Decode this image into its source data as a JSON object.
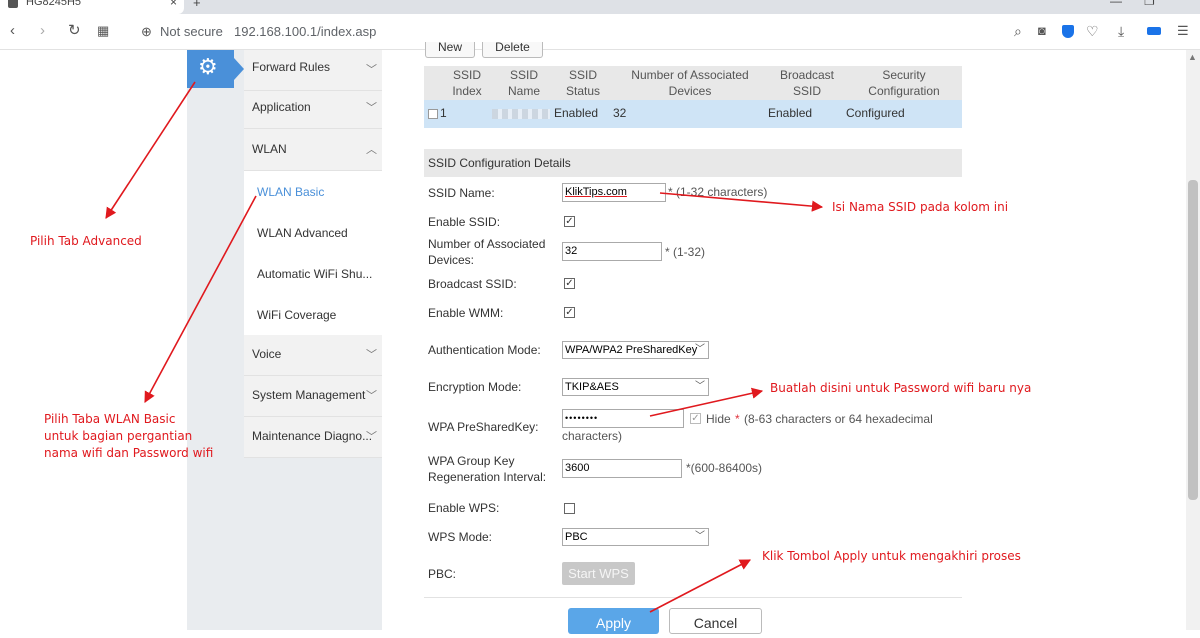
{
  "browser": {
    "tab_title": "HG8245H5",
    "tab_close": "×",
    "new_tab": "+",
    "not_secure": "Not secure",
    "url": "192.168.100.1/index.asp",
    "icons": [
      "back-icon",
      "forward-icon",
      "reload-icon",
      "apps-icon",
      "globe-icon",
      "search-icon",
      "camera-icon",
      "shield-icon",
      "heart-icon",
      "download-icon",
      "battery-icon",
      "menu-icon"
    ]
  },
  "sidebar": {
    "gear_icon": "⚙",
    "items": [
      {
        "label": "Forward Rules",
        "chevron": "﹀"
      },
      {
        "label": "Application",
        "chevron": "﹀"
      },
      {
        "label": "WLAN",
        "chevron": "︿"
      },
      {
        "label": "Voice",
        "chevron": "﹀"
      },
      {
        "label": "System Management",
        "chevron": "﹀"
      },
      {
        "label": "Maintenance Diagno...",
        "chevron": "﹀"
      }
    ],
    "wlan_sub": [
      {
        "label": "WLAN Basic",
        "active": true
      },
      {
        "label": "WLAN Advanced"
      },
      {
        "label": "Automatic WiFi Shu..."
      },
      {
        "label": "WiFi Coverage"
      }
    ]
  },
  "ssid_table": {
    "new_label": "New",
    "delete_label": "Delete",
    "headers": [
      "SSID Index",
      "SSID Name",
      "SSID Status",
      "Number of Associated Devices",
      "Broadcast SSID",
      "Security Configuration"
    ],
    "row": {
      "index": "1",
      "status": "Enabled",
      "devices": "32",
      "broadcast": "Enabled",
      "security": "Configured"
    }
  },
  "details": {
    "title": "SSID Configuration Details",
    "ssid_name_label": "SSID Name:",
    "ssid_name_value": "KlikTips.com",
    "ssid_name_hint": "* (1-32 characters)",
    "enable_ssid_label": "Enable SSID:",
    "assoc_label": "Number of Associated Devices:",
    "assoc_value": "32",
    "assoc_hint": "* (1-32)",
    "broadcast_label": "Broadcast SSID:",
    "wmm_label": "Enable WMM:",
    "auth_label": "Authentication Mode:",
    "auth_value": "WPA/WPA2 PreSharedKey",
    "enc_label": "Encryption Mode:",
    "enc_value": "TKIP&AES",
    "psk_label": "WPA PreSharedKey:",
    "psk_value": "••••••••",
    "hide_label": "Hide",
    "psk_hint_star": "*",
    "psk_hint": "(8-63 characters or 64 hexadecimal",
    "psk_hint2": "characters)",
    "rekey_label": "WPA Group Key Regeneration Interval:",
    "rekey_value": "3600",
    "rekey_hint": "*(600-86400s)",
    "wps_label": "Enable WPS:",
    "wps_mode_label": "WPS Mode:",
    "wps_mode_value": "PBC",
    "pbc_label": "PBC:",
    "start_wps": "Start WPS",
    "apply": "Apply",
    "cancel": "Cancel",
    "check_mark": "✓"
  },
  "annotations": {
    "tab_advanced": "Pilih Tab Advanced",
    "wlan_basic": [
      "Pilih Taba WLAN Basic",
      "untuk bagian pergantian",
      "nama wifi dan Password wifi"
    ],
    "ssid_name": "Isi Nama SSID pada kolom ini",
    "password": "Buatlah disini untuk Password wifi baru nya",
    "apply": "Klik Tombol Apply untuk mengakhiri proses"
  },
  "colors": {
    "accent": "#4a90d9",
    "annotation": "#e0191e",
    "row_highlight": "#cfe4f6"
  }
}
